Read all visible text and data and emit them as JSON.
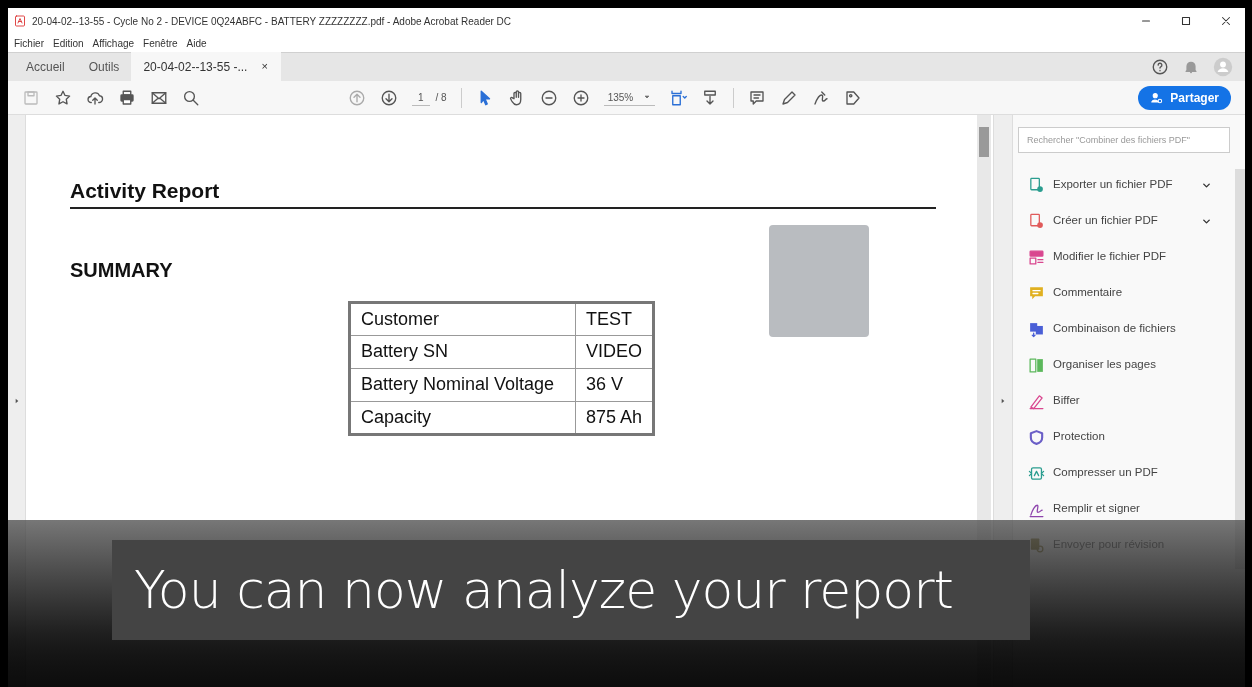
{
  "window": {
    "title": "20-04-02--13-55 - Cycle No 2 - DEVICE 0Q24ABFC - BATTERY ZZZZZZZZ.pdf - Adobe Acrobat Reader DC"
  },
  "menu": [
    "Fichier",
    "Edition",
    "Affichage",
    "Fenêtre",
    "Aide"
  ],
  "tabs": [
    {
      "label": "Accueil",
      "selected": false,
      "closable": false
    },
    {
      "label": "Outils",
      "selected": false,
      "closable": false
    },
    {
      "label": "20-04-02--13-55 -...",
      "selected": true,
      "closable": true
    }
  ],
  "tab_close": "×",
  "toolbar": {
    "page": "1",
    "page_count": "/ 8",
    "zoom": "135%",
    "share": "Partager"
  },
  "document": {
    "title": "Activity Report",
    "summary": "SUMMARY",
    "table": [
      [
        "Customer",
        "TEST"
      ],
      [
        "Battery SN",
        "VIDEO"
      ],
      [
        "Battery Nominal Voltage",
        "36 V"
      ],
      [
        "Capacity",
        "875 Ah"
      ]
    ]
  },
  "tools_panel": {
    "search": {
      "placeholder": "Rechercher \"Combiner des fichiers PDF\""
    },
    "items": [
      {
        "label": "Exporter un fichier PDF",
        "kind": "export",
        "color": "#2a9d8f",
        "expandable": true
      },
      {
        "label": "Créer un fichier PDF",
        "kind": "create",
        "color": "#e05a5a",
        "expandable": true
      },
      {
        "label": "Modifier le fichier PDF",
        "kind": "edit",
        "color": "#d9468f",
        "expandable": false
      },
      {
        "label": "Commentaire",
        "kind": "comment",
        "color": "#e0b020",
        "expandable": false
      },
      {
        "label": "Combinaison de fichiers",
        "kind": "combine",
        "color": "#4a5fd6",
        "expandable": false
      },
      {
        "label": "Organiser les pages",
        "kind": "organize",
        "color": "#5cb85c",
        "expandable": false
      },
      {
        "label": "Biffer",
        "kind": "redact",
        "color": "#d9468f",
        "expandable": false
      },
      {
        "label": "Protection",
        "kind": "protect",
        "color": "#6b5fc7",
        "expandable": false
      },
      {
        "label": "Compresser un PDF",
        "kind": "compress",
        "color": "#2a9d8f",
        "expandable": false
      },
      {
        "label": "Remplir et signer",
        "kind": "sign",
        "color": "#8e44ad",
        "expandable": false
      },
      {
        "label": "Envoyer pour révision",
        "kind": "review",
        "expandable": false
      }
    ]
  },
  "caption": "You can now analyze your report"
}
